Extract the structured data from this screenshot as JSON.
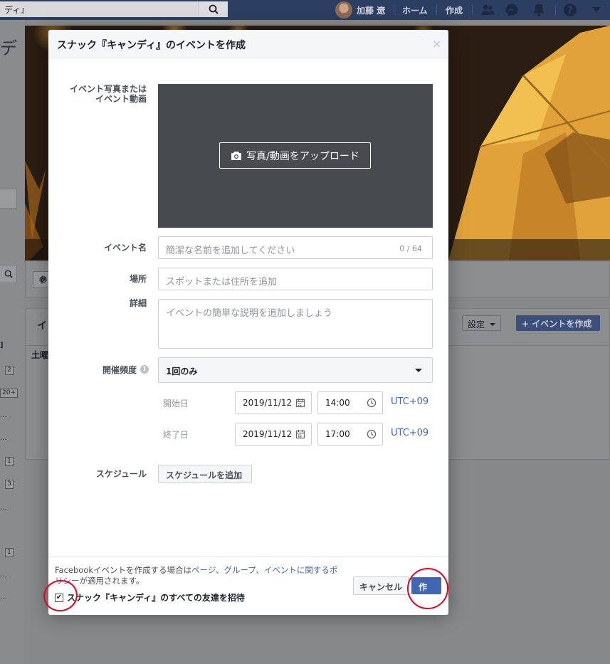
{
  "topbar": {
    "search_value": "ディ』",
    "user_name": "加藤 遼",
    "home": "ホーム",
    "create": "作成"
  },
  "background": {
    "page_title_fragment": "デ",
    "card_button_fragment": "参",
    "events_tab_fragment": "イ",
    "settings_button": "設定",
    "create_event_button": "+ イベントを作成",
    "saturday": "土曜",
    "left_badges": [
      "2",
      "20+",
      "1",
      "3",
      "1"
    ],
    "left_fragment": "]"
  },
  "modal": {
    "title": "スナック『キャンディ』のイベントを作成",
    "photo_label_line1": "イベント写真または",
    "photo_label_line2": "イベント動画",
    "upload_button": "写真/動画をアップロード",
    "name_label": "イベント名",
    "name_placeholder": "簡潔な名前を追加してください",
    "name_counter": "0 / 64",
    "place_label": "場所",
    "place_placeholder": "スポットまたは住所を追加",
    "details_label": "詳細",
    "details_placeholder": "イベントの簡単な説明を追加しましょう",
    "frequency_label": "開催頻度",
    "frequency_value": "1回のみ",
    "start_label": "開始日",
    "start_date": "2019/11/12",
    "start_time": "14:00",
    "end_label": "終了日",
    "end_date": "2019/11/12",
    "end_time": "17:00",
    "timezone": "UTC+09",
    "schedule_label": "スケジュール",
    "schedule_button": "スケジュールを追加",
    "policy_prefix": "Facebookイベントを作成する場合は",
    "policy_link1": "ページ、グループ、イベントに関するポ",
    "policy_link2": "リシー",
    "policy_suffix": "が適用されます。",
    "invite_label": "スナック『キャンディ』のすべての友達を招待",
    "invite_checked": true,
    "cancel_button": "キャンセル",
    "create_button": "作成"
  },
  "colors": {
    "accent": "#4267b2",
    "topbar": "#2c3e61",
    "annotation": "#e8001c"
  }
}
